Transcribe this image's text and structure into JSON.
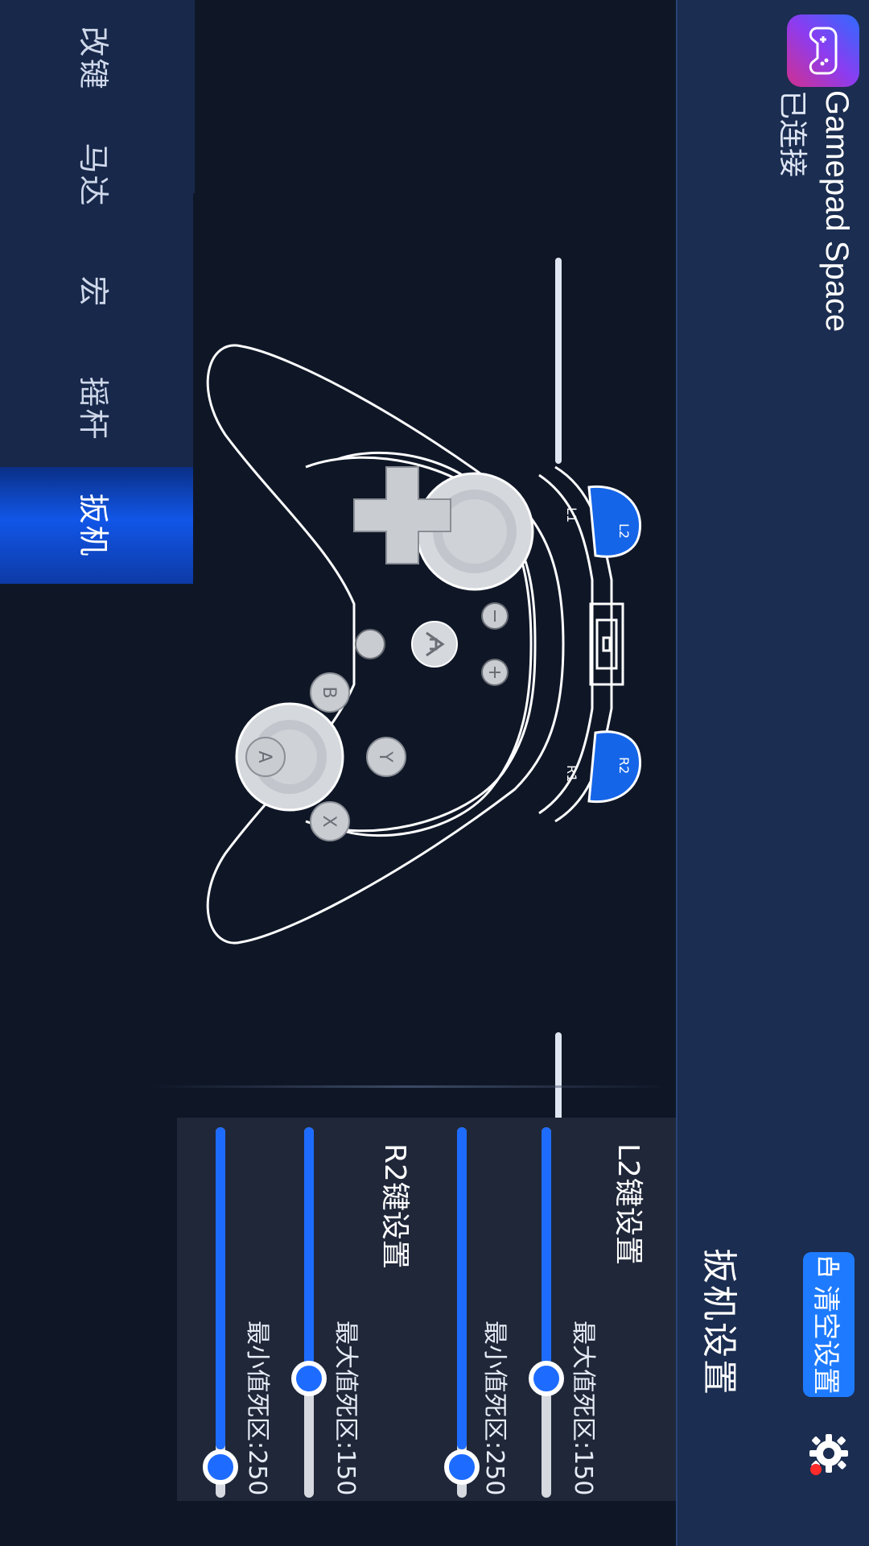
{
  "app": {
    "name": "Gamepad Space",
    "status": "已连接",
    "clear_label": "清空设置"
  },
  "tabs": [
    {
      "label": "改键",
      "active": false
    },
    {
      "label": "马达",
      "active": false
    },
    {
      "label": "宏",
      "active": false
    },
    {
      "label": "摇杆",
      "active": false
    },
    {
      "label": "扳机",
      "active": true
    }
  ],
  "controller": {
    "labels": {
      "l1": "L1",
      "l2": "L2",
      "r1": "R1",
      "r2": "R2"
    },
    "face_buttons": [
      "Y",
      "X",
      "B",
      "A"
    ],
    "trigger_color": "#1565e8"
  },
  "panel": {
    "title": "扳机设置",
    "sections": [
      {
        "title": "L2键设置",
        "sliders": [
          {
            "label": "最大值死区:150",
            "value": 0.17
          },
          {
            "label": "最小值死区:250",
            "value": 0.03
          }
        ]
      },
      {
        "title": "R2键设置",
        "sliders": [
          {
            "label": "最大值死区:150",
            "value": 0.17
          },
          {
            "label": "最小值死区:250",
            "value": 0.03
          }
        ]
      }
    ]
  },
  "colors": {
    "accent": "#1e6cff",
    "background": "#0f1727",
    "sidebar": "#1b2d50",
    "active_tab": "#1156e8"
  }
}
